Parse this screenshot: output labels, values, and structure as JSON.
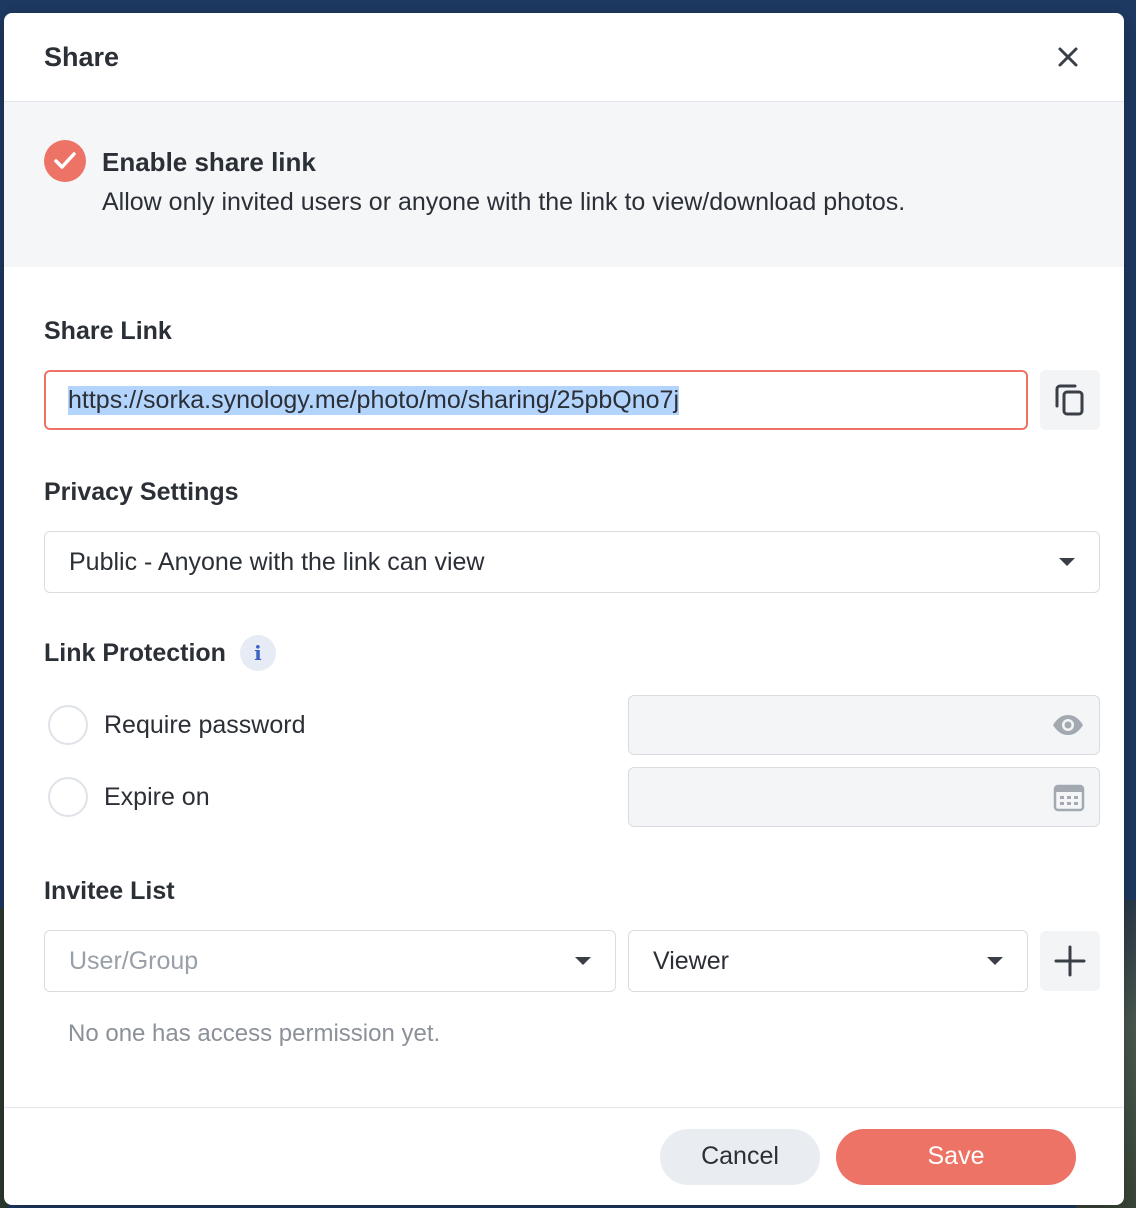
{
  "dialog": {
    "title": "Share"
  },
  "enable": {
    "title": "Enable share link",
    "description": "Allow only invited users or anyone with the link to view/download photos.",
    "checked": true
  },
  "share_link": {
    "label": "Share Link",
    "value": "https://sorka.synology.me/photo/mo/sharing/25pbQno7j"
  },
  "privacy": {
    "label": "Privacy Settings",
    "selected": "Public - Anyone with the link can view"
  },
  "protection": {
    "label": "Link Protection",
    "info_icon": "i",
    "password_label": "Require password",
    "expire_label": "Expire on"
  },
  "invitees": {
    "label": "Invitee List",
    "user_placeholder": "User/Group",
    "role_selected": "Viewer",
    "empty_message": "No one has access permission yet."
  },
  "footer": {
    "cancel_label": "Cancel",
    "save_label": "Save"
  },
  "colors": {
    "accent": "#ec7365",
    "text": "#2b2f36"
  }
}
